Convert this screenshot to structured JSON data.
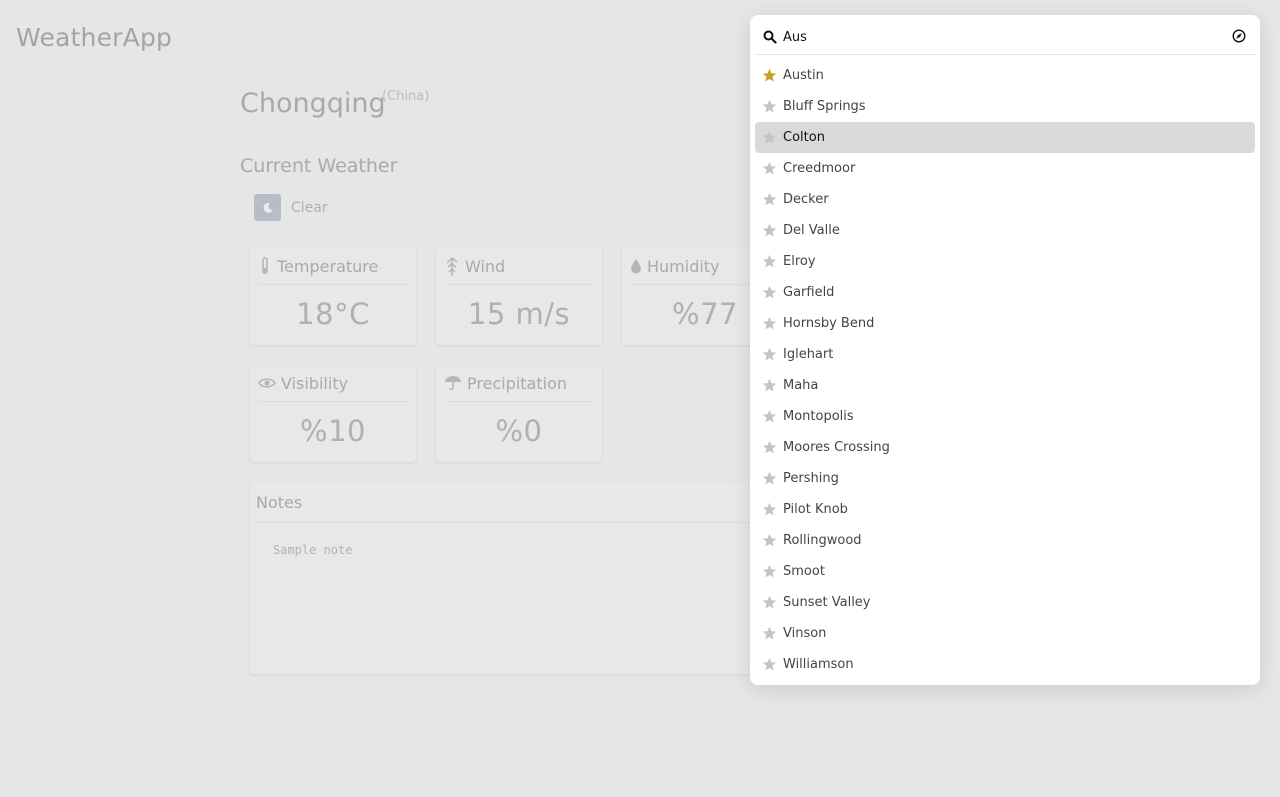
{
  "app": {
    "title": "WeatherApp"
  },
  "location": {
    "city": "Chongqing",
    "country": "(China)"
  },
  "current": {
    "section_title": "Current Weather",
    "condition": "Clear",
    "condition_icon": "moon-icon"
  },
  "metrics": [
    {
      "label": "Temperature",
      "value": "18°C",
      "icon": "thermometer-icon"
    },
    {
      "label": "Wind",
      "value": "15 m/s",
      "icon": "wind-icon"
    },
    {
      "label": "Humidity",
      "value": "%77",
      "icon": "droplet-icon"
    },
    {
      "label": "Visibility",
      "value": "%10",
      "icon": "eye-icon"
    },
    {
      "label": "Precipitation",
      "value": "%0",
      "icon": "umbrella-icon"
    }
  ],
  "notes": {
    "title": "Notes",
    "text": "Sample note"
  },
  "search": {
    "value": "Aus",
    "results": [
      {
        "label": "Austin",
        "favorite": true
      },
      {
        "label": "Bluff Springs",
        "favorite": false
      },
      {
        "label": "Colton",
        "favorite": false,
        "highlighted": true
      },
      {
        "label": "Creedmoor",
        "favorite": false
      },
      {
        "label": "Decker",
        "favorite": false
      },
      {
        "label": "Del Valle",
        "favorite": false
      },
      {
        "label": "Elroy",
        "favorite": false
      },
      {
        "label": "Garfield",
        "favorite": false
      },
      {
        "label": "Hornsby Bend",
        "favorite": false
      },
      {
        "label": "Iglehart",
        "favorite": false
      },
      {
        "label": "Maha",
        "favorite": false
      },
      {
        "label": "Montopolis",
        "favorite": false
      },
      {
        "label": "Moores Crossing",
        "favorite": false
      },
      {
        "label": "Pershing",
        "favorite": false
      },
      {
        "label": "Pilot Knob",
        "favorite": false
      },
      {
        "label": "Rollingwood",
        "favorite": false
      },
      {
        "label": "Smoot",
        "favorite": false
      },
      {
        "label": "Sunset Valley",
        "favorite": false
      },
      {
        "label": "Vinson",
        "favorite": false
      },
      {
        "label": "Williamson",
        "favorite": false
      }
    ]
  },
  "colors": {
    "favorite_star": "#c9a227",
    "inactive_star": "#c4c4c4",
    "highlight": "#d9d9d9"
  }
}
